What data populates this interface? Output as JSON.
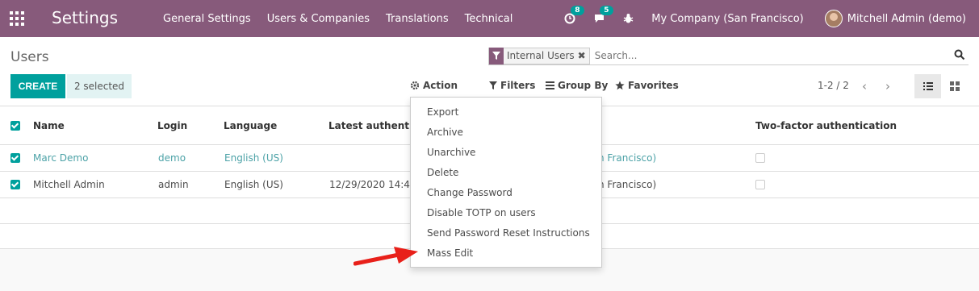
{
  "navbar": {
    "brand": "Settings",
    "menu": [
      "General Settings",
      "Users & Companies",
      "Translations",
      "Technical"
    ],
    "activity_badge": "8",
    "messages_badge": "5",
    "company": "My Company (San Francisco)",
    "user": "Mitchell Admin (demo)",
    "color": "#875a7b"
  },
  "control_panel": {
    "breadcrumb": "Users",
    "facet_label": "Internal Users",
    "search_placeholder": "Search...",
    "create_label": "CREATE",
    "selected_label": "2 selected",
    "action_label": "Action",
    "filters_label": "Filters",
    "groupby_label": "Group By",
    "favorites_label": "Favorites",
    "pager": "1-2 / 2"
  },
  "table": {
    "headers": [
      "Name",
      "Login",
      "Language",
      "Latest authentica",
      "Two-factor authentication"
    ],
    "rows": [
      {
        "name": "Marc Demo",
        "login": "demo",
        "language": "English (US)",
        "latest": "",
        "company": "n Francisco)"
      },
      {
        "name": "Mitchell Admin",
        "login": "admin",
        "language": "English (US)",
        "latest": "12/29/2020 14:4",
        "company": "n Francisco)"
      }
    ]
  },
  "action_menu": {
    "items": [
      "Export",
      "Archive",
      "Unarchive",
      "Delete",
      "Change Password",
      "Disable TOTP on users",
      "Send Password Reset Instructions",
      "Mass Edit"
    ]
  },
  "colors": {
    "primary": "#00a09d",
    "link": "#4ca2a7",
    "arrow": "#e8201a"
  }
}
